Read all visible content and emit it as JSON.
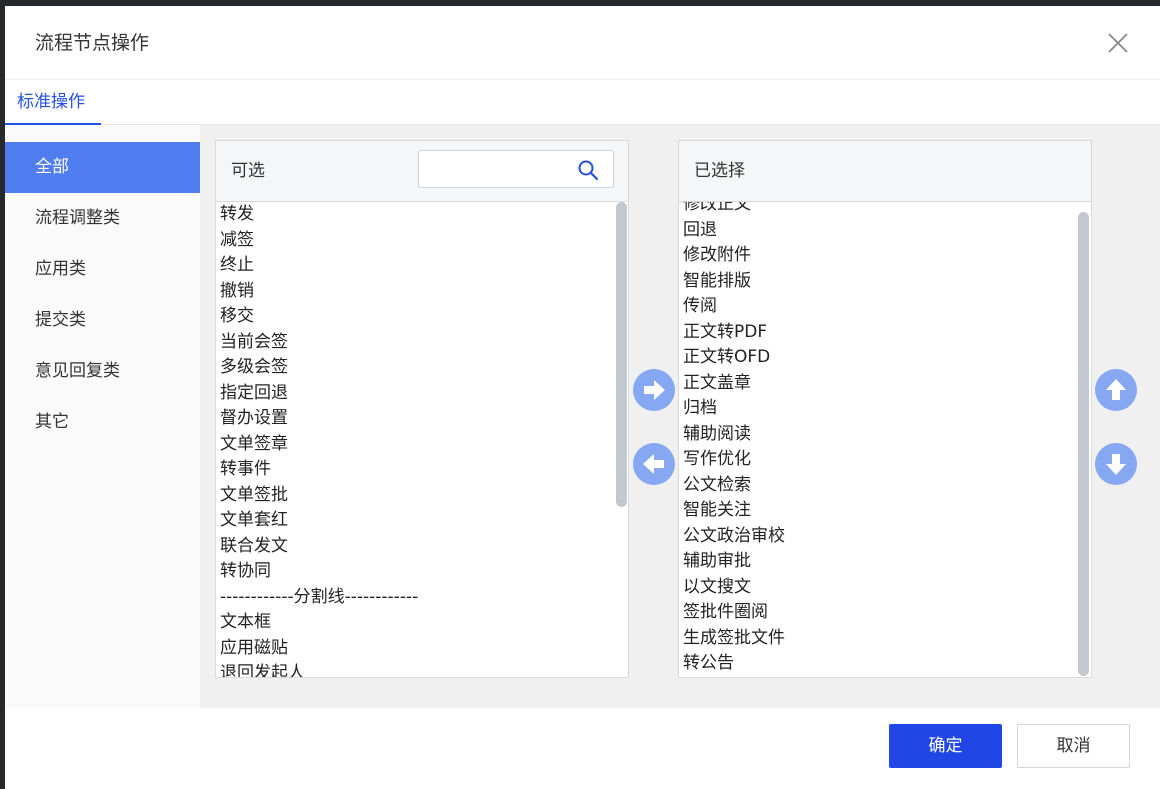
{
  "dialog": {
    "title": "流程节点操作"
  },
  "tabs": [
    {
      "label": "标准操作"
    }
  ],
  "sidebar": {
    "items": [
      {
        "label": "全部"
      },
      {
        "label": "流程调整类"
      },
      {
        "label": "应用类"
      },
      {
        "label": "提交类"
      },
      {
        "label": "意见回复类"
      },
      {
        "label": "其它"
      }
    ]
  },
  "available": {
    "title": "可选",
    "search_value": "",
    "items": [
      "转发",
      "减签",
      "终止",
      "撤销",
      "移交",
      "当前会签",
      "多级会签",
      "指定回退",
      "督办设置",
      "文单签章",
      "转事件",
      "文单签批",
      "文单套红",
      "联合发文",
      "转协同",
      "------------分割线------------",
      "文本框",
      "应用磁贴",
      "退回发起人"
    ]
  },
  "selected": {
    "title": "已选择",
    "items": [
      "修改正文",
      "回退",
      "修改附件",
      "智能排版",
      "传阅",
      "正文转PDF",
      "正文转OFD",
      "正文盖章",
      "归档",
      "辅助阅读",
      "写作优化",
      "公文检索",
      "智能关注",
      "公文政治审校",
      "辅助审批",
      "以文搜文",
      "签批件圈阅",
      "生成签批文件",
      "转公告"
    ]
  },
  "footer": {
    "confirm_label": "确定",
    "cancel_label": "取消"
  },
  "colors": {
    "accent": "#2047e6",
    "sidebar_active": "#4f7df0",
    "arrow_button": "#86a7f2"
  }
}
